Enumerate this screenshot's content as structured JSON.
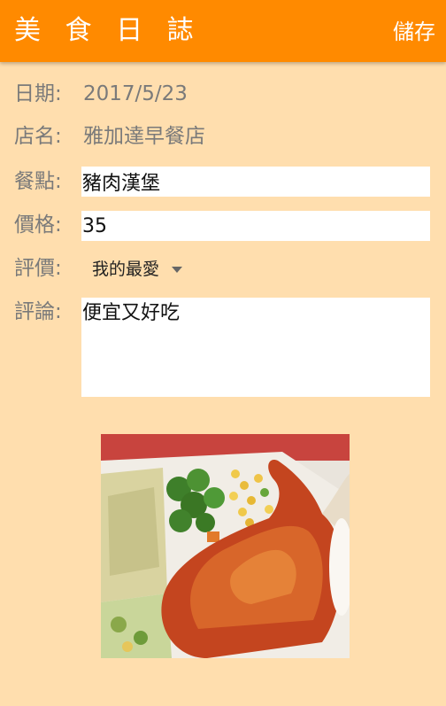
{
  "app_bar": {
    "title": "美 食 日 誌",
    "save_label": "儲存",
    "color": "#FF8A00"
  },
  "form": {
    "date": {
      "label": "日期:",
      "value": "2017/5/23"
    },
    "store": {
      "label": "店名:",
      "value": "雅加達早餐店"
    },
    "meal": {
      "label": "餐點:",
      "value": "豬肉漢堡"
    },
    "price": {
      "label": "價格:",
      "value": "35"
    },
    "rating": {
      "label": "評價:",
      "value": "我的最愛"
    },
    "comment": {
      "label": "評論:",
      "value": "便宜又好吃"
    }
  },
  "photo": {
    "icon": "food-photo"
  },
  "colors": {
    "background": "#FFDEAE",
    "accent": "#FF8A00"
  }
}
